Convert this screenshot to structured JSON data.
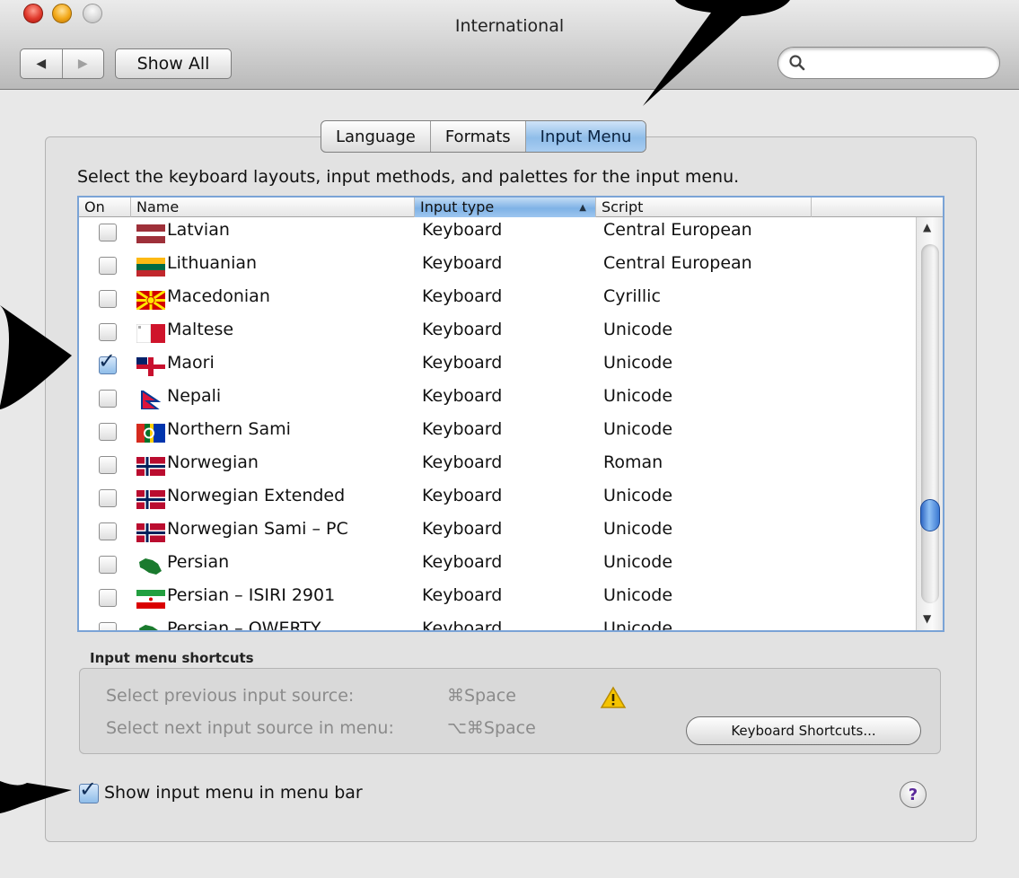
{
  "window": {
    "title": "International",
    "show_all_label": "Show All",
    "back_glyph": "◀",
    "forward_glyph": "▶",
    "search_placeholder": ""
  },
  "tabs": [
    {
      "label": "Language",
      "active": false
    },
    {
      "label": "Formats",
      "active": false
    },
    {
      "label": "Input Menu",
      "active": true
    }
  ],
  "instruction": "Select the keyboard layouts, input methods, and palettes for the input menu.",
  "table": {
    "columns": {
      "on": "On",
      "name": "Name",
      "input_type": "Input type",
      "script": "Script"
    },
    "sorted_column": "Input type",
    "sort_glyph": "▲",
    "rows": [
      {
        "checked": false,
        "name": "Latvian",
        "input_type": "Keyboard",
        "script": "Central European",
        "flag": "latvia-flag-icon"
      },
      {
        "checked": false,
        "name": "Lithuanian",
        "input_type": "Keyboard",
        "script": "Central European",
        "flag": "lithuania-flag-icon"
      },
      {
        "checked": false,
        "name": "Macedonian",
        "input_type": "Keyboard",
        "script": "Cyrillic",
        "flag": "macedonia-flag-icon"
      },
      {
        "checked": false,
        "name": "Maltese",
        "input_type": "Keyboard",
        "script": "Unicode",
        "flag": "malta-flag-icon"
      },
      {
        "checked": true,
        "name": "Maori",
        "input_type": "Keyboard",
        "script": "Unicode",
        "flag": "new-zealand-flag-icon"
      },
      {
        "checked": false,
        "name": "Nepali",
        "input_type": "Keyboard",
        "script": "Unicode",
        "flag": "nepal-flag-icon"
      },
      {
        "checked": false,
        "name": "Northern Sami",
        "input_type": "Keyboard",
        "script": "Unicode",
        "flag": "sami-flag-icon"
      },
      {
        "checked": false,
        "name": "Norwegian",
        "input_type": "Keyboard",
        "script": "Roman",
        "flag": "norway-flag-icon"
      },
      {
        "checked": false,
        "name": "Norwegian Extended",
        "input_type": "Keyboard",
        "script": "Unicode",
        "flag": "norway-flag-icon"
      },
      {
        "checked": false,
        "name": "Norwegian Sami – PC",
        "input_type": "Keyboard",
        "script": "Unicode",
        "flag": "norway-flag-icon"
      },
      {
        "checked": false,
        "name": "Persian",
        "input_type": "Keyboard",
        "script": "Unicode",
        "flag": "iran-map-icon"
      },
      {
        "checked": false,
        "name": "Persian – ISIRI 2901",
        "input_type": "Keyboard",
        "script": "Unicode",
        "flag": "iran-flag-icon"
      },
      {
        "checked": false,
        "name": "Persian – QWERTY",
        "input_type": "Keyboard",
        "script": "Unicode",
        "flag": "iran-map-icon"
      }
    ],
    "scroll_position": 0.78
  },
  "shortcuts": {
    "title": "Input menu shortcuts",
    "previous_label": "Select previous input source:",
    "previous_key": "⌘Space",
    "next_label": "Select next input source in menu:",
    "next_key": "⌥⌘Space",
    "button_label": "Keyboard Shortcuts..."
  },
  "show_in_menu_bar": {
    "label": "Show input menu in menu bar",
    "checked": true
  },
  "help_label": "?",
  "check_glyph": "✓",
  "colors": {
    "accent": "#8fbde9",
    "callout": "#000000",
    "warning": "#f5c400"
  }
}
